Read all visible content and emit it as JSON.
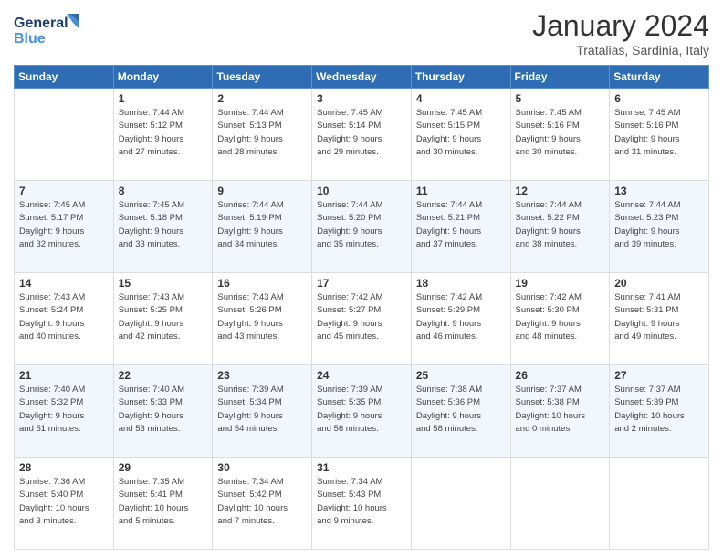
{
  "header": {
    "logo_line1": "General",
    "logo_line2": "Blue",
    "month": "January 2024",
    "location": "Tratalias, Sardinia, Italy"
  },
  "weekdays": [
    "Sunday",
    "Monday",
    "Tuesday",
    "Wednesday",
    "Thursday",
    "Friday",
    "Saturday"
  ],
  "weeks": [
    [
      {
        "day": "",
        "info": ""
      },
      {
        "day": "1",
        "info": "Sunrise: 7:44 AM\nSunset: 5:12 PM\nDaylight: 9 hours\nand 27 minutes."
      },
      {
        "day": "2",
        "info": "Sunrise: 7:44 AM\nSunset: 5:13 PM\nDaylight: 9 hours\nand 28 minutes."
      },
      {
        "day": "3",
        "info": "Sunrise: 7:45 AM\nSunset: 5:14 PM\nDaylight: 9 hours\nand 29 minutes."
      },
      {
        "day": "4",
        "info": "Sunrise: 7:45 AM\nSunset: 5:15 PM\nDaylight: 9 hours\nand 30 minutes."
      },
      {
        "day": "5",
        "info": "Sunrise: 7:45 AM\nSunset: 5:16 PM\nDaylight: 9 hours\nand 30 minutes."
      },
      {
        "day": "6",
        "info": "Sunrise: 7:45 AM\nSunset: 5:16 PM\nDaylight: 9 hours\nand 31 minutes."
      }
    ],
    [
      {
        "day": "7",
        "info": "Sunrise: 7:45 AM\nSunset: 5:17 PM\nDaylight: 9 hours\nand 32 minutes."
      },
      {
        "day": "8",
        "info": "Sunrise: 7:45 AM\nSunset: 5:18 PM\nDaylight: 9 hours\nand 33 minutes."
      },
      {
        "day": "9",
        "info": "Sunrise: 7:44 AM\nSunset: 5:19 PM\nDaylight: 9 hours\nand 34 minutes."
      },
      {
        "day": "10",
        "info": "Sunrise: 7:44 AM\nSunset: 5:20 PM\nDaylight: 9 hours\nand 35 minutes."
      },
      {
        "day": "11",
        "info": "Sunrise: 7:44 AM\nSunset: 5:21 PM\nDaylight: 9 hours\nand 37 minutes."
      },
      {
        "day": "12",
        "info": "Sunrise: 7:44 AM\nSunset: 5:22 PM\nDaylight: 9 hours\nand 38 minutes."
      },
      {
        "day": "13",
        "info": "Sunrise: 7:44 AM\nSunset: 5:23 PM\nDaylight: 9 hours\nand 39 minutes."
      }
    ],
    [
      {
        "day": "14",
        "info": "Sunrise: 7:43 AM\nSunset: 5:24 PM\nDaylight: 9 hours\nand 40 minutes."
      },
      {
        "day": "15",
        "info": "Sunrise: 7:43 AM\nSunset: 5:25 PM\nDaylight: 9 hours\nand 42 minutes."
      },
      {
        "day": "16",
        "info": "Sunrise: 7:43 AM\nSunset: 5:26 PM\nDaylight: 9 hours\nand 43 minutes."
      },
      {
        "day": "17",
        "info": "Sunrise: 7:42 AM\nSunset: 5:27 PM\nDaylight: 9 hours\nand 45 minutes."
      },
      {
        "day": "18",
        "info": "Sunrise: 7:42 AM\nSunset: 5:29 PM\nDaylight: 9 hours\nand 46 minutes."
      },
      {
        "day": "19",
        "info": "Sunrise: 7:42 AM\nSunset: 5:30 PM\nDaylight: 9 hours\nand 48 minutes."
      },
      {
        "day": "20",
        "info": "Sunrise: 7:41 AM\nSunset: 5:31 PM\nDaylight: 9 hours\nand 49 minutes."
      }
    ],
    [
      {
        "day": "21",
        "info": "Sunrise: 7:40 AM\nSunset: 5:32 PM\nDaylight: 9 hours\nand 51 minutes."
      },
      {
        "day": "22",
        "info": "Sunrise: 7:40 AM\nSunset: 5:33 PM\nDaylight: 9 hours\nand 53 minutes."
      },
      {
        "day": "23",
        "info": "Sunrise: 7:39 AM\nSunset: 5:34 PM\nDaylight: 9 hours\nand 54 minutes."
      },
      {
        "day": "24",
        "info": "Sunrise: 7:39 AM\nSunset: 5:35 PM\nDaylight: 9 hours\nand 56 minutes."
      },
      {
        "day": "25",
        "info": "Sunrise: 7:38 AM\nSunset: 5:36 PM\nDaylight: 9 hours\nand 58 minutes."
      },
      {
        "day": "26",
        "info": "Sunrise: 7:37 AM\nSunset: 5:38 PM\nDaylight: 10 hours\nand 0 minutes."
      },
      {
        "day": "27",
        "info": "Sunrise: 7:37 AM\nSunset: 5:39 PM\nDaylight: 10 hours\nand 2 minutes."
      }
    ],
    [
      {
        "day": "28",
        "info": "Sunrise: 7:36 AM\nSunset: 5:40 PM\nDaylight: 10 hours\nand 3 minutes."
      },
      {
        "day": "29",
        "info": "Sunrise: 7:35 AM\nSunset: 5:41 PM\nDaylight: 10 hours\nand 5 minutes."
      },
      {
        "day": "30",
        "info": "Sunrise: 7:34 AM\nSunset: 5:42 PM\nDaylight: 10 hours\nand 7 minutes."
      },
      {
        "day": "31",
        "info": "Sunrise: 7:34 AM\nSunset: 5:43 PM\nDaylight: 10 hours\nand 9 minutes."
      },
      {
        "day": "",
        "info": ""
      },
      {
        "day": "",
        "info": ""
      },
      {
        "day": "",
        "info": ""
      }
    ]
  ]
}
